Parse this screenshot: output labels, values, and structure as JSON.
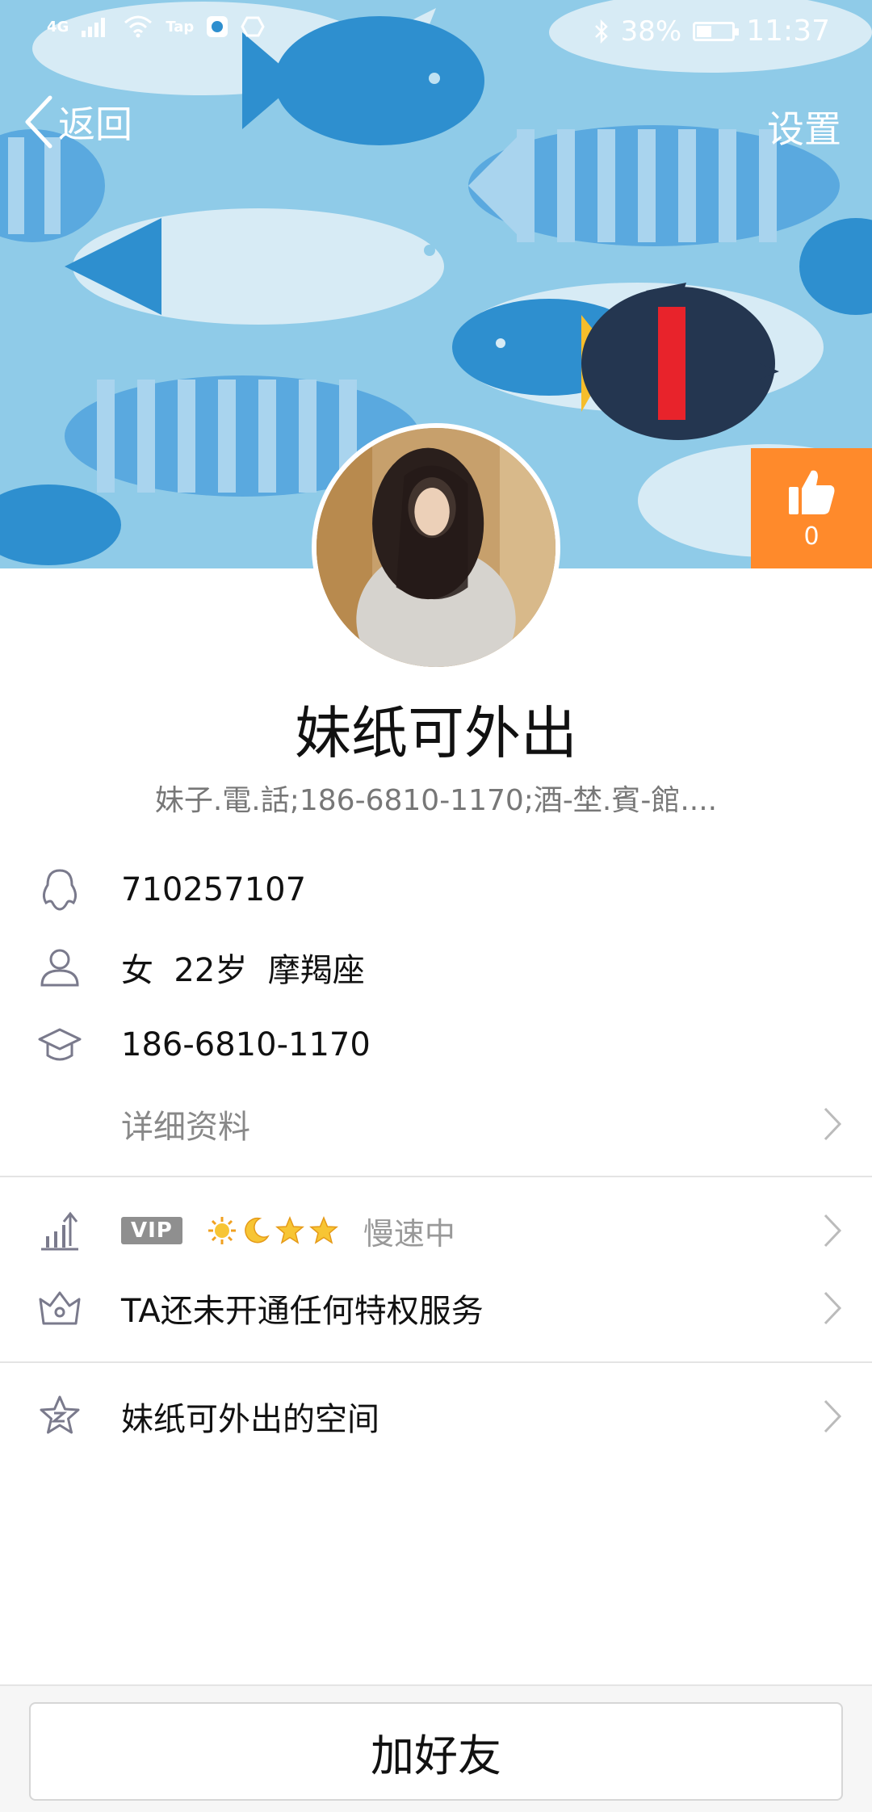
{
  "status_bar": {
    "network": "4G",
    "carrier_app": "Tap",
    "battery_percent": "38%",
    "time": "11:37"
  },
  "nav": {
    "back_label": "返回",
    "settings_label": "设置"
  },
  "like": {
    "count": "0"
  },
  "profile": {
    "nickname": "妹纸可外出",
    "signature": "妹子.電.話;186-6810-1170;酒-埜.賓-館...."
  },
  "info": {
    "qq_number": "710257107",
    "basic": "女  22岁  摩羯座",
    "school": "186-6810-1170",
    "details_label": "详细资料"
  },
  "vip": {
    "badge": "VIP",
    "level_icons": [
      "sun-icon",
      "moon-icon",
      "star-icon",
      "star-icon"
    ],
    "speed_status": "慢速中",
    "privilege_text": "TA还未开通任何特权服务"
  },
  "space": {
    "label": "妹纸可外出的空间"
  },
  "bottom": {
    "add_friend_label": "加好友"
  },
  "colors": {
    "cover_bg": "#8fcbe8",
    "like_orange": "#ff8a2b",
    "icon_gray": "#7a7a8c"
  }
}
